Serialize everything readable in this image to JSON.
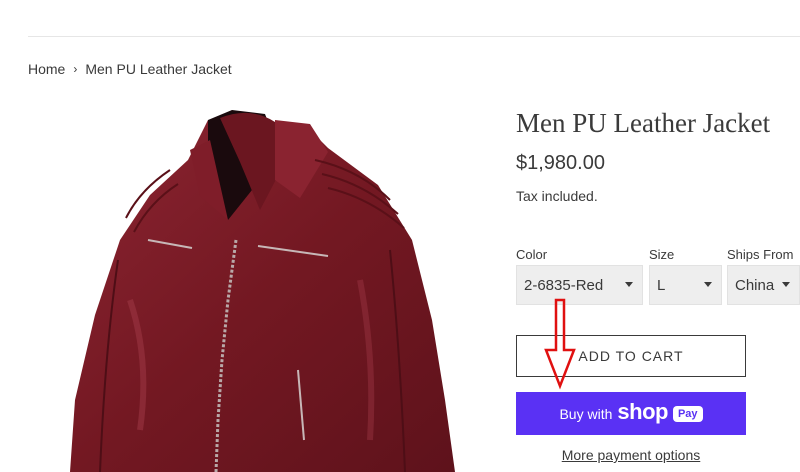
{
  "breadcrumb": {
    "home": "Home",
    "separator": "›",
    "current": "Men PU Leather Jacket"
  },
  "product": {
    "title": "Men PU Leather Jacket",
    "price": "$1,980.00",
    "tax_note": "Tax included.",
    "image_alt": "Men PU Leather Jacket"
  },
  "options": {
    "color": {
      "label": "Color",
      "value": "2-6835-Red"
    },
    "size": {
      "label": "Size",
      "value": "L"
    },
    "ships_from": {
      "label": "Ships From",
      "value": "China"
    }
  },
  "actions": {
    "add_to_cart": "ADD TO CART",
    "shop_pay_prefix": "Buy with",
    "shop_pay_brand": "shop",
    "shop_pay_badge": "Pay",
    "more_payment": "More payment options"
  },
  "colors": {
    "jacket": "#7a1a26",
    "shop_pay": "#5a31f4",
    "annotation_arrow": "#e01010"
  }
}
